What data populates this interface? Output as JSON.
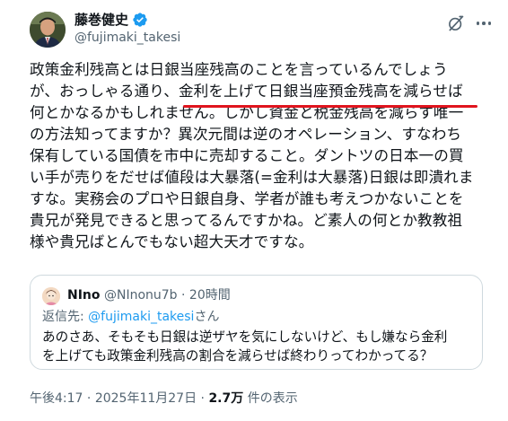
{
  "author": {
    "name": "藤巻健史",
    "handle": "@fujimaki_takesi"
  },
  "tweet": {
    "lines": [
      "政策金利残高とは日銀当座残高のことを言っているんでしょう",
      "が、おっしゃる通り、金利を上げて日銀当座預金残高を減らせば",
      "何とかなるかもしれません。しかし資金と税金残高を減らす唯一",
      "の方法知ってますか？異次元間は逆のオペレーション、すなわち",
      "保有している国債を市中に売却すること。ダントツの日本一の買",
      "い手が売りをだせば値段は大暴落(=金利は大暴落)日銀は即潰れま",
      "すな。実務会のプロや日銀自身、学者が誰も考えつかないことを",
      "貴兄が発見できると思ってるんですかね。ど素人の何とか教教祖",
      "様や貴兄ばとんでもない超大天才ですな。"
    ]
  },
  "quote": {
    "name": "NIno",
    "handle": "@NInonu7b",
    "separator": "·",
    "time": "20時間",
    "reply_prefix": "返信先: ",
    "reply_mention": "@fujimaki_takesi",
    "reply_suffix": "さん",
    "lines": [
      "あのさあ、そもそも日銀は逆ザヤを気にしないけど、もし嫌なら金利",
      "を上げても政策金利残高の割合を減らせば終わりってわかってる？"
    ]
  },
  "meta": {
    "time": "午後4:17",
    "separator": " · ",
    "date": "2025年11月27日",
    "separator2": " · ",
    "views": "2.7万",
    "views_label": " 件の表示"
  },
  "colors": {
    "text": "#0f1419",
    "secondary": "#536471",
    "verified": "#1d9bf0",
    "highlight_underline": "#e0141e",
    "border": "#cfd9de"
  },
  "icons": {
    "verified": "verified-badge-icon",
    "grok": "grok-icon",
    "more": "more-options-icon"
  }
}
